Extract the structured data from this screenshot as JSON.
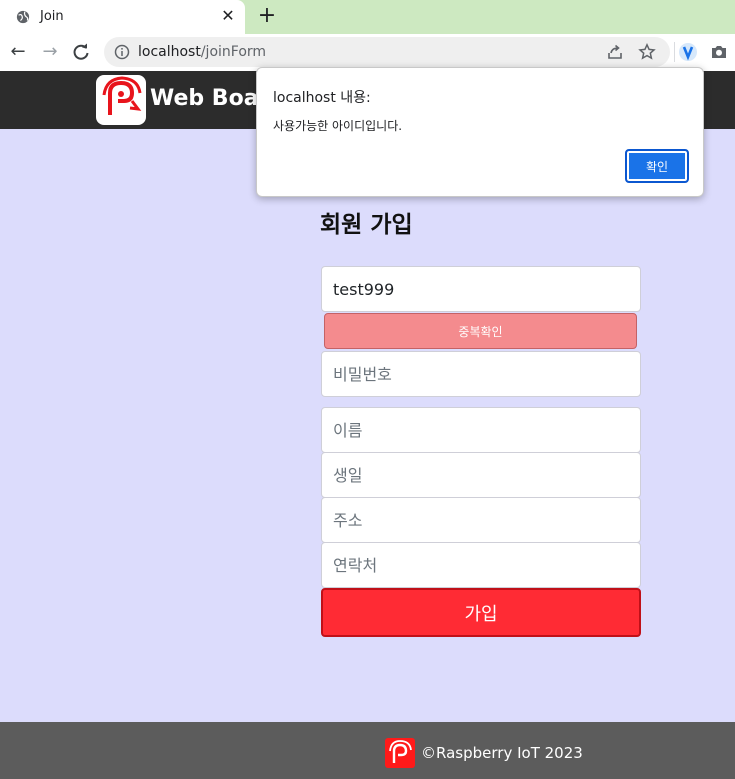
{
  "browser": {
    "tab_title": "Join",
    "url_host": "localhost",
    "url_path": "/joinForm",
    "colors": {
      "tabbar_bg": "#cde9c1",
      "omnibox_bg": "#efefef"
    }
  },
  "site": {
    "title": "Web Boar",
    "header_bg": "#2c2c2c"
  },
  "form": {
    "title": "회원 가입",
    "userid_value": "test999",
    "dup_check_label": "중복확인",
    "password_placeholder": "비밀번호",
    "name_placeholder": "이름",
    "birth_placeholder": "생일",
    "address_placeholder": "주소",
    "phone_placeholder": "연락처",
    "submit_label": "가입",
    "colors": {
      "submit_bg": "#ff2b34",
      "dup_bg": "#f48b8e",
      "page_bg": "#dcdcfc"
    }
  },
  "footer": {
    "text": "©Raspberry IoT 2023"
  },
  "dialog": {
    "title": "localhost 내용:",
    "message": "사용가능한 아이디입니다.",
    "ok_label": "확인"
  }
}
